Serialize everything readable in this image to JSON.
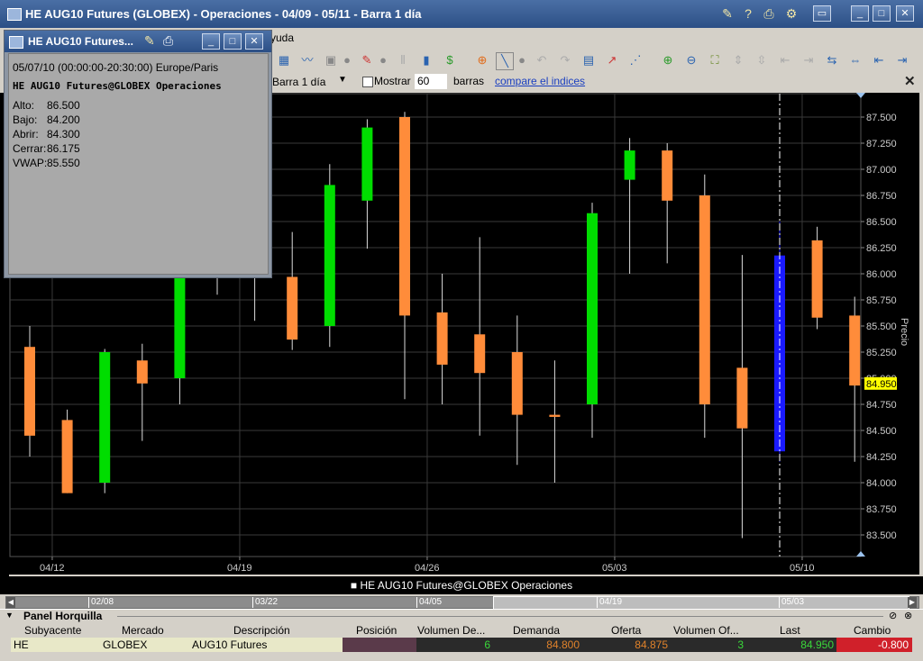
{
  "window": {
    "title": "HE AUG10 Futures (GLOBEX) - Operaciones - 04/09 - 05/11 - Barra 1 día"
  },
  "menu": {
    "partial_item": "yuda"
  },
  "options": {
    "bar_select": "Barra 1 día",
    "show_label": "Mostrar",
    "show_value": "60",
    "bars_label": "barras",
    "compare_link": "compare el indices"
  },
  "popup": {
    "title": "HE AUG10 Futures...",
    "line_time": "05/07/10 (00:00:00-20:30:00) Europe/Paris",
    "line_name": "HE AUG10 Futures@GLOBEX Operaciones",
    "fields": [
      {
        "label": "Alto:",
        "value": "86.500"
      },
      {
        "label": "Bajo:",
        "value": "84.200"
      },
      {
        "label": "Abrir:",
        "value": "84.300"
      },
      {
        "label": "Cerrar:",
        "value": "86.175"
      },
      {
        "label": "VWAP:",
        "value": "85.550"
      }
    ]
  },
  "chart_data": {
    "type": "candlestick",
    "ylabel": "Precio",
    "ylim": [
      83.3,
      87.7
    ],
    "yticks": [
      "87.500",
      "87.250",
      "87.000",
      "86.750",
      "86.500",
      "86.250",
      "86.000",
      "85.750",
      "85.500",
      "85.250",
      "85.000",
      "84.750",
      "84.500",
      "84.250",
      "84.000",
      "83.750",
      "83.500"
    ],
    "xticks": [
      {
        "label": "04/12",
        "index": 0.6
      },
      {
        "label": "04/19",
        "index": 5.6
      },
      {
        "label": "04/26",
        "index": 10.6
      },
      {
        "label": "05/03",
        "index": 15.6
      },
      {
        "label": "05/10",
        "index": 20.6
      }
    ],
    "current_price": "84.950",
    "current_price_color": "#ffff00",
    "series_name": "HE AUG10 Futures@GLOBEX Operaciones",
    "colors": {
      "up": "#00dd00",
      "down": "#ff8c3a",
      "selected": "#1a1aff"
    },
    "candles": [
      {
        "open": 85.3,
        "close": 84.45,
        "high": 85.5,
        "low": 84.25
      },
      {
        "open": 84.6,
        "close": 83.9,
        "high": 84.7,
        "low": 83.9
      },
      {
        "open": 84.0,
        "close": 85.25,
        "high": 85.28,
        "low": 83.9
      },
      {
        "open": 85.17,
        "close": 84.95,
        "high": 85.33,
        "low": 84.4
      },
      {
        "open": 85.0,
        "close": 86.2,
        "high": 86.35,
        "low": 84.75
      },
      {
        "open": 86.0,
        "close": 86.1,
        "high": 86.2,
        "low": 85.8
      },
      {
        "open": 86.0,
        "close": 86.05,
        "high": 86.1,
        "low": 85.55
      },
      {
        "open": 85.97,
        "close": 85.37,
        "high": 86.4,
        "low": 85.27
      },
      {
        "open": 85.5,
        "close": 86.85,
        "high": 87.05,
        "low": 85.3
      },
      {
        "open": 86.7,
        "close": 87.4,
        "high": 87.48,
        "low": 86.24
      },
      {
        "open": 87.5,
        "close": 85.6,
        "high": 87.55,
        "low": 84.8
      },
      {
        "open": 85.63,
        "close": 85.13,
        "high": 86.0,
        "low": 84.75
      },
      {
        "open": 85.42,
        "close": 85.05,
        "high": 86.35,
        "low": 84.45
      },
      {
        "open": 85.25,
        "close": 84.65,
        "high": 85.6,
        "low": 84.17
      },
      {
        "open": 84.65,
        "close": 84.63,
        "high": 85.17,
        "low": 84.0
      },
      {
        "open": 84.75,
        "close": 86.58,
        "high": 86.68,
        "low": 84.43
      },
      {
        "open": 86.9,
        "close": 87.18,
        "high": 87.3,
        "low": 86.0
      },
      {
        "open": 87.18,
        "close": 86.7,
        "high": 87.25,
        "low": 86.1
      },
      {
        "open": 86.75,
        "close": 84.75,
        "high": 86.95,
        "low": 84.43
      },
      {
        "open": 85.1,
        "close": 84.52,
        "high": 86.18,
        "low": 83.47
      },
      {
        "open": 84.3,
        "close": 86.175,
        "high": 86.5,
        "low": 84.2,
        "selected": true
      },
      {
        "open": 86.32,
        "close": 85.58,
        "high": 86.45,
        "low": 85.47
      },
      {
        "open": 85.6,
        "close": 84.93,
        "high": 85.78,
        "low": 84.2
      }
    ]
  },
  "scrollbar": {
    "labels": [
      "02/08",
      "03/22",
      "04/05",
      "04/19",
      "05/03"
    ]
  },
  "panel": {
    "title": "Panel Horquilla",
    "columns": [
      "Subyacente",
      "Mercado",
      "Descripción",
      "Posición",
      "Volumen De...",
      "Demanda",
      "Oferta",
      "Volumen Of...",
      "Last",
      "Cambio"
    ],
    "row": {
      "underlying": "HE",
      "market": "GLOBEX",
      "description": "AUG10 Futures",
      "position": "",
      "bid_volume": "6",
      "bid": "84.800",
      "ask": "84.875",
      "ask_volume": "3",
      "last": "84.950",
      "change": "-0.800"
    }
  }
}
